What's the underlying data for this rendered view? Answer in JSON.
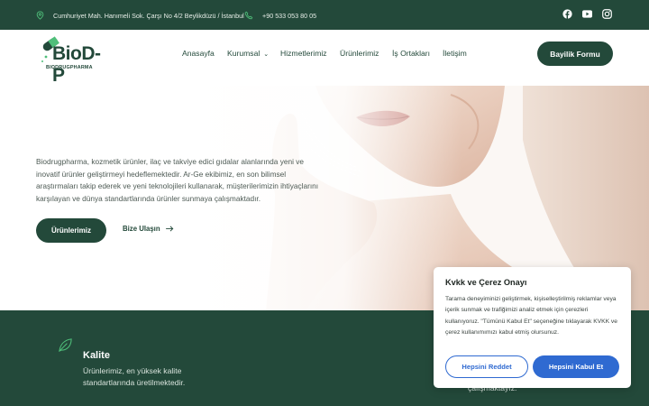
{
  "topbar": {
    "address": "Cumhuriyet Mah. Hanımeli Sok. Çarşı No 4/2 Beylikdüzü / İstanbul",
    "phone": "+90 533 053 80 05",
    "social": [
      "facebook-icon",
      "youtube-icon",
      "instagram-icon"
    ]
  },
  "header": {
    "logo_text": "BioD-P",
    "logo_sub": "BIODRUGPHARMA",
    "nav": [
      "Anasayfa",
      "Kurumsal",
      "Hizmetlerimiz",
      "Ürünlerimiz",
      "İş Ortakları",
      "İletişim"
    ],
    "cta": "Bayilik Formu"
  },
  "hero": {
    "text": "Biodrugpharma, kozmetik ürünler, ilaç ve takviye edici gıdalar alanlarında yeni ve inovatif ürünler geliştirmeyi hedeflemektedir. Ar-Ge ekibimiz, en son bilimsel araştırmaları takip ederek ve yeni teknolojileri kullanarak, müşterilerimizin ihtiyaçlarını karşılayan ve dünya standartlarında ürünler sunmaya çalışmaktadır.",
    "primary_button": "Ürünlerimiz",
    "link_button": "Bize Ulaşın"
  },
  "features": {
    "title": "Kalite",
    "desc": "Ürünlerimiz, en yüksek kalite standartlarında üretilmektedir.",
    "partial_text": "çalışmaktayız."
  },
  "cookie": {
    "title": "Kvkk ve Çerez Onayı",
    "body": "Tarama deneyiminizi geliştirmek, kişiselleştirilmiş reklamlar veya içerik sunmak ve trafiğimizi analiz etmek için çerezleri kullanıyoruz. \"Tümünü Kabul Et\" seçeneğine tıklayarak KVKK ve çerez kullanımımızı kabul etmiş olursunuz.",
    "reject": "Hepsini Reddet",
    "accept": "Hepsini Kabul Et"
  },
  "colors": {
    "brand": "#23493a",
    "cookie_accent": "#2f6ad1"
  }
}
